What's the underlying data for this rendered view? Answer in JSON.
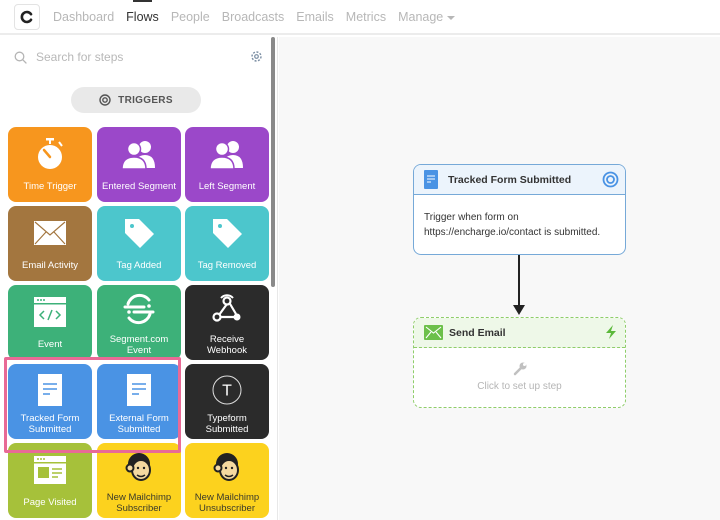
{
  "app": {
    "logo_letter": "C",
    "nav": [
      {
        "label": "Dashboard",
        "active": false
      },
      {
        "label": "Flows",
        "active": true
      },
      {
        "label": "People",
        "active": false
      },
      {
        "label": "Broadcasts",
        "active": false
      },
      {
        "label": "Emails",
        "active": false
      },
      {
        "label": "Metrics",
        "active": false
      },
      {
        "label": "Manage",
        "active": false,
        "dropdown": true
      }
    ]
  },
  "sidebar": {
    "search_placeholder": "Search for steps",
    "search_value": "",
    "section_label": "TRIGGERS",
    "tiles": [
      {
        "label": "Time Trigger",
        "icon": "stopwatch-icon",
        "color": "#f7961e"
      },
      {
        "label": "Entered Segment",
        "icon": "users-icon",
        "color": "#9b48c9"
      },
      {
        "label": "Left Segment",
        "icon": "users-icon",
        "color": "#9b48c9"
      },
      {
        "label": "Email Activity",
        "icon": "envelope-icon",
        "color": "#a3763f"
      },
      {
        "label": "Tag Added",
        "icon": "tag-icon",
        "color": "#4cc6cc"
      },
      {
        "label": "Tag Removed",
        "icon": "tag-icon",
        "color": "#4cc6cc"
      },
      {
        "label": "Event",
        "icon": "code-window-icon",
        "color": "#3db179"
      },
      {
        "label_line1": "Segment.com",
        "label_line2": "Event",
        "icon": "segment-logo-icon",
        "color": "#3db179"
      },
      {
        "label_line1": "Receive",
        "label_line2": "Webhook",
        "icon": "webhook-icon",
        "color": "#2b2b2b"
      },
      {
        "label_line1": "Tracked Form",
        "label_line2": "Submitted",
        "icon": "form-document-icon",
        "color": "#4a93e4",
        "highlighted": true
      },
      {
        "label_line1": "External Form",
        "label_line2": "Submitted",
        "icon": "form-document-icon",
        "color": "#4a93e4",
        "highlighted": true
      },
      {
        "label_line1": "Typeform",
        "label_line2": "Submitted",
        "icon": "typeform-icon",
        "color": "#2b2b2b"
      },
      {
        "label": "Page Visited",
        "icon": "webpage-icon",
        "color": "#a6c13a"
      },
      {
        "label_line1": "New Mailchimp",
        "label_line2": "Subscriber",
        "icon": "mailchimp-icon",
        "color": "#fcd21e"
      },
      {
        "label_line1": "New Mailchimp",
        "label_line2": "Unsubscriber",
        "icon": "mailchimp-icon",
        "color": "#fcd21e"
      }
    ]
  },
  "flow": {
    "trigger_node": {
      "title": "Tracked Form Submitted",
      "description_line1": "Trigger when form on",
      "description_line2": "https://encharge.io/contact is submitted."
    },
    "action_node": {
      "title": "Send Email",
      "placeholder": "Click to set up step"
    }
  },
  "colors": {
    "trigger_border": "#76a9d8",
    "action_border": "#8fcd6a",
    "highlight": "#e86a96"
  }
}
